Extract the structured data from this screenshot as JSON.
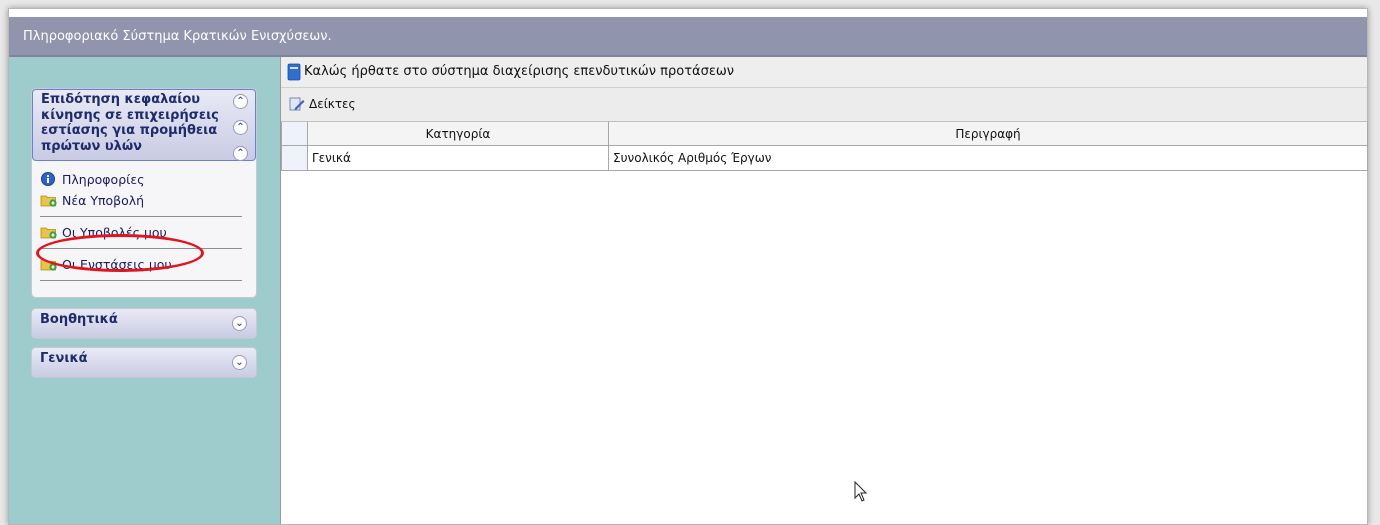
{
  "app": {
    "title": "Πληροφοριακό Σύστημα Κρατικών Ενισχύσεων."
  },
  "sidebar": {
    "panel1": {
      "title_lines": [
        "Επιδότηση κεφαλαίου",
        "κίνησης σε επιχειρήσεις",
        "εστίασης για προμήθεια",
        "πρώτων υλών"
      ],
      "items": [
        {
          "label": "Πληροφορίες",
          "icon": "info-icon"
        },
        {
          "label": "Νέα Υποβολή",
          "icon": "folder-add-icon"
        },
        {
          "label": "Οι Υποβολές μου",
          "icon": "folder-add-icon"
        },
        {
          "label": "Οι Ενστάσεις μου",
          "icon": "folder-add-icon"
        }
      ]
    },
    "panel2": {
      "title": "Βοηθητικά"
    },
    "panel3": {
      "title": "Γενικά"
    }
  },
  "main": {
    "welcome_text": "Καλώς ήρθατε στο σύστημα διαχείρισης επενδυτικών προτάσεων",
    "toolbar": {
      "indicators_label": "Δείκτες"
    },
    "table": {
      "columns": [
        "Κατηγορία",
        "Περιγραφή"
      ],
      "rows": [
        {
          "category": "Γενικά",
          "description": "Συνολικός Αριθμός Έργων"
        }
      ]
    }
  },
  "colors": {
    "titlebar": "#9094ad",
    "sidebar": "#9ecbcc",
    "annotation": "#e0151d",
    "panel_title": "#1e2c6b"
  }
}
